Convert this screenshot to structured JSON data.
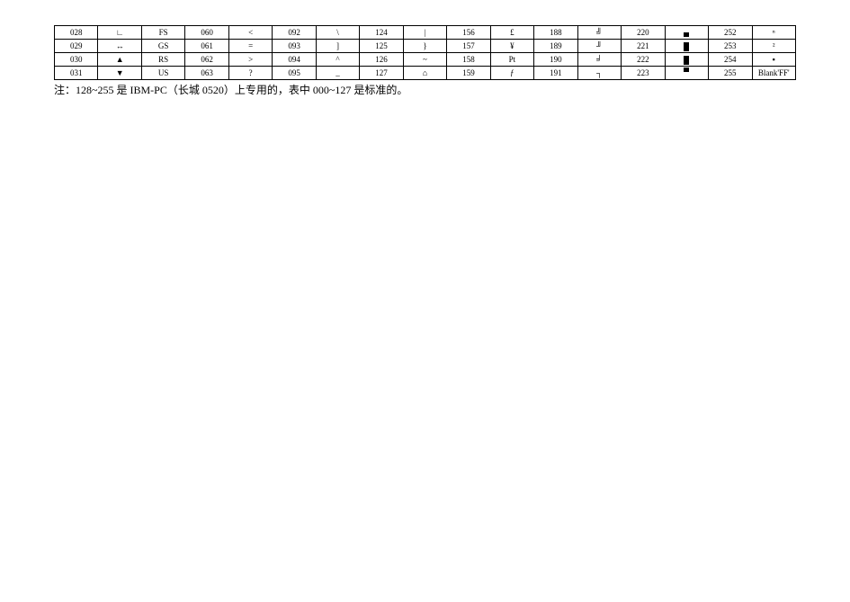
{
  "table": {
    "rows": [
      [
        {
          "code": "028",
          "char": "∟"
        },
        {
          "code": "FS",
          "char": "060"
        },
        {
          "code": "<",
          "char": "092"
        },
        {
          "code": "\\",
          "char": "124"
        },
        {
          "code": "|",
          "char": "156"
        },
        {
          "code": "£",
          "char": "188"
        },
        {
          "code": "╝",
          "char": "220"
        },
        {
          "code": "▄",
          "char": "252"
        },
        {
          "code": "ⁿ",
          "char": ""
        }
      ],
      [
        {
          "code": "029",
          "char": "↔"
        },
        {
          "code": "GS",
          "char": "061"
        },
        {
          "code": "=",
          "char": "093"
        },
        {
          "code": "]",
          "char": "125"
        },
        {
          "code": "}",
          "char": "157"
        },
        {
          "code": "¥",
          "char": "189"
        },
        {
          "code": "╜",
          "char": "221"
        },
        {
          "code": "▌",
          "char": "253"
        },
        {
          "code": "²",
          "char": ""
        }
      ],
      [
        {
          "code": "030",
          "char": "▲"
        },
        {
          "code": "RS",
          "char": "062"
        },
        {
          "code": ">",
          "char": "094"
        },
        {
          "code": "^",
          "char": "126"
        },
        {
          "code": "~",
          "char": "158"
        },
        {
          "code": "Pt",
          "char": "190"
        },
        {
          "code": "╛",
          "char": "222"
        },
        {
          "code": "▐",
          "char": "254"
        },
        {
          "code": "▪",
          "char": ""
        }
      ],
      [
        {
          "code": "031",
          "char": "▼"
        },
        {
          "code": "US",
          "char": "063"
        },
        {
          "code": "?",
          "char": "095"
        },
        {
          "code": "_",
          "char": "127"
        },
        {
          "code": "⌂",
          "char": "159"
        },
        {
          "code": "ƒ",
          "char": "191"
        },
        {
          "code": "┐",
          "char": "223"
        },
        {
          "code": "▀",
          "char": "255"
        },
        {
          "code": "Blank'FF'",
          "char": ""
        }
      ]
    ]
  },
  "note": "注：128~255 是 IBM-PC（长城 0520）上专用的，表中 000~127 是标准的。"
}
